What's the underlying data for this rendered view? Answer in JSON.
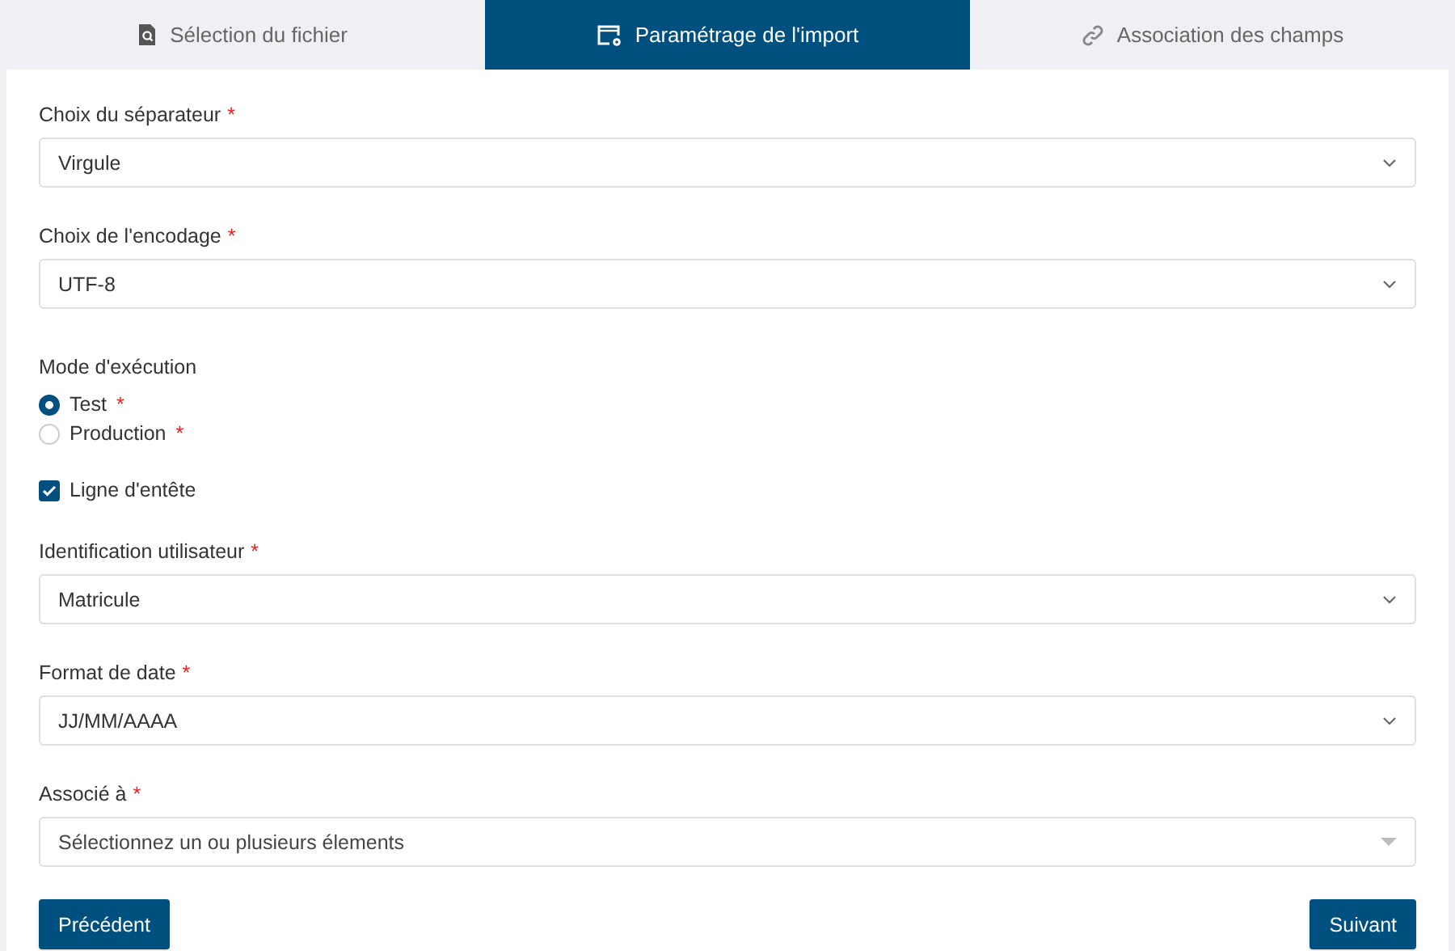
{
  "tabs": [
    {
      "label": "Sélection du fichier",
      "selected": false
    },
    {
      "label": "Paramétrage de l'import",
      "selected": true
    },
    {
      "label": "Association des champs",
      "selected": false
    }
  ],
  "fields": [
    {
      "kind": "select",
      "label": "Choix du séparateur",
      "required_mark": "*",
      "value": "Virgule"
    },
    {
      "kind": "select",
      "label": "Choix de l'encodage",
      "required_mark": "*",
      "value": "UTF-8"
    },
    {
      "kind": "radio",
      "label": "Mode d'exécution",
      "options": [
        {
          "label": "Test",
          "required_mark": "*",
          "selected": true
        },
        {
          "label": "Production",
          "required_mark": "*",
          "selected": false
        }
      ]
    },
    {
      "kind": "checkbox",
      "label": "Ligne d'entête",
      "checked": true
    },
    {
      "kind": "select",
      "label": "Identification utilisateur",
      "required_mark": "*",
      "value": "Matricule"
    },
    {
      "kind": "select",
      "label": "Format de date",
      "required_mark": "*",
      "value": "JJ/MM/AAAA"
    },
    {
      "kind": "multiselect",
      "label": "Associé à",
      "required_mark": "*",
      "placeholder": "Sélectionnez un ou plusieurs élements"
    }
  ],
  "buttons": [
    {
      "label": "Précédent"
    },
    {
      "label": "Suivant"
    }
  ]
}
